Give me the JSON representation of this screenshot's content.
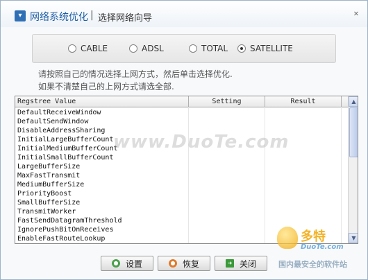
{
  "window": {
    "title": "网络系统优化",
    "separator": "|",
    "subtitle": "选择网络向导",
    "close_glyph": "✕"
  },
  "connection_types": {
    "options": [
      {
        "label": "CABLE",
        "checked": false
      },
      {
        "label": "ADSL",
        "checked": false
      },
      {
        "label": "TOTAL",
        "checked": false
      },
      {
        "label": "SATELLITE",
        "checked": true
      }
    ]
  },
  "instructions": {
    "line1": "请按照自己的情况选择上网方式，然后单击选择优化.",
    "line2": "如果不清楚自己的上网方式请选全部."
  },
  "table": {
    "headers": [
      "Regstree Value",
      "Setting",
      "Result"
    ],
    "rows": [
      [
        "DefaultReceiveWindow",
        "",
        ""
      ],
      [
        "DefaultSendWindow",
        "",
        ""
      ],
      [
        "DisableAddressSharing",
        "",
        ""
      ],
      [
        "InitialLargeBufferCount",
        "",
        ""
      ],
      [
        "InitialMediumBufferCount",
        "",
        ""
      ],
      [
        "InitialSmallBufferCount",
        "",
        ""
      ],
      [
        "LargeBufferSize",
        "",
        ""
      ],
      [
        "MaxFastTransmit",
        "",
        ""
      ],
      [
        "MediumBufferSize",
        "",
        ""
      ],
      [
        "PriorityBoost",
        "",
        ""
      ],
      [
        "SmallBufferSize",
        "",
        ""
      ],
      [
        "TransmitWorker",
        "",
        ""
      ],
      [
        "FastSendDatagramThreshold",
        "",
        ""
      ],
      [
        "IgnorePushBitOnReceives",
        "",
        ""
      ],
      [
        "EnableFastRouteLookup",
        "",
        ""
      ]
    ]
  },
  "buttons": {
    "setup": "设置",
    "restore": "恢复",
    "close": "关闭"
  },
  "watermark": {
    "text": "www.DuoTe.com",
    "logo_main": "多特",
    "logo_sub": "DuoTe.com",
    "logo_tag": "国内最安全的软件站"
  },
  "icons": {
    "title": "window-app-icon",
    "close": "close-icon",
    "setup": "gear-icon",
    "restore": "restore-icon",
    "exit": "exit-arrow-icon",
    "scroll_up": "chevron-up-icon",
    "scroll_down": "chevron-down-icon"
  }
}
